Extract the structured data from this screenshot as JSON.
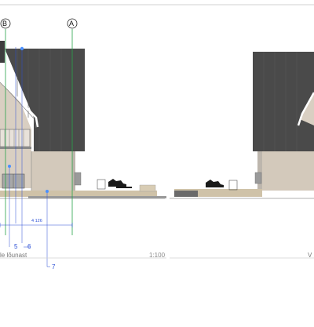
{
  "grid_markers": {
    "b": "B",
    "a": "A"
  },
  "detail_tags": [
    "5",
    "6",
    "7"
  ],
  "dimension_text": "4 126",
  "view_left": {
    "title": "le lõunast",
    "scale": "1:100"
  },
  "view_right": {
    "title_partial": "V"
  },
  "colors": {
    "roof": "#4a4a4a",
    "wall": "#d9cfc2",
    "gridline": "#27a34a",
    "dimension": "#2b4fd6"
  }
}
